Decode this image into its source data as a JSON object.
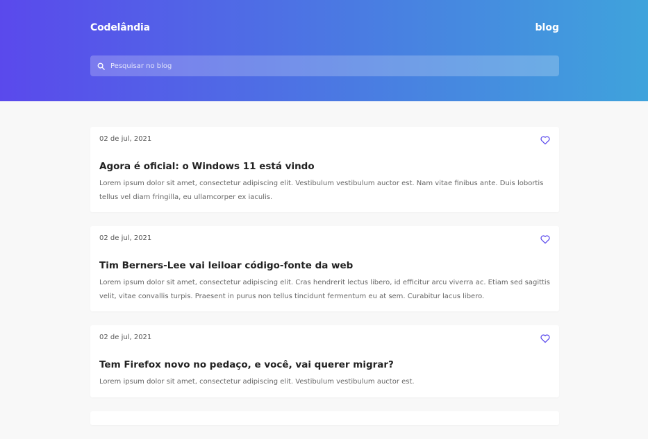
{
  "header": {
    "brand": "Codelândia",
    "nav_label": "blog",
    "search_placeholder": "Pesquisar no blog"
  },
  "posts": [
    {
      "date": "02 de jul, 2021",
      "title": "Agora é oficial: o Windows 11 está vindo",
      "excerpt": "Lorem ipsum dolor sit amet, consectetur adipiscing elit. Vestibulum vestibulum auctor est. Nam vitae finibus ante. Duis lobortis tellus vel diam fringilla, eu ullamcorper ex iaculis."
    },
    {
      "date": "02 de jul, 2021",
      "title": "Tim Berners-Lee vai leiloar código-fonte da web",
      "excerpt": "Lorem ipsum dolor sit amet, consectetur adipiscing elit. Cras hendrerit lectus libero, id efficitur arcu viverra ac. Etiam sed sagittis velit, vitae convallis turpis. Praesent in purus non tellus tincidunt fermentum eu at sem. Curabitur lacus libero."
    },
    {
      "date": "02 de jul, 2021",
      "title": "Tem Firefox novo no pedaço, e você, vai querer migrar?",
      "excerpt": "Lorem ipsum dolor sit amet, consectetur adipiscing elit. Vestibulum vestibulum auctor est."
    }
  ],
  "icons": {
    "search": "search-icon",
    "favorite": "heart-icon"
  },
  "colors": {
    "gradient_start": "#5a49ec",
    "gradient_end": "#3fa3dc",
    "heart": "#5a49ec"
  }
}
